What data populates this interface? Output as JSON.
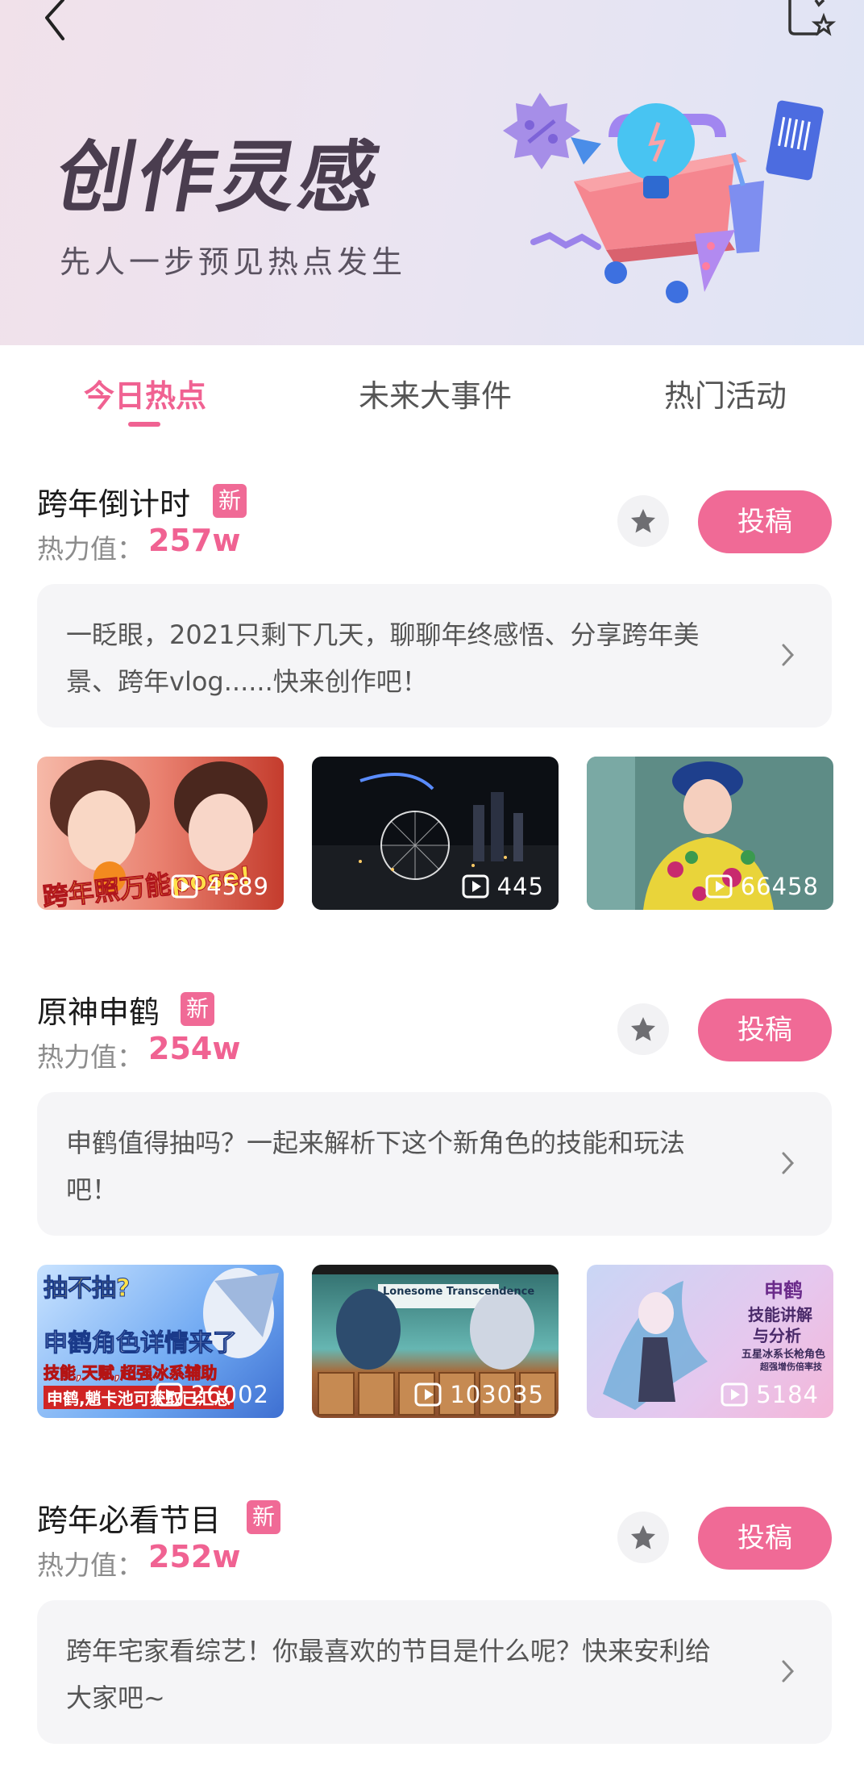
{
  "header": {
    "title": "创作灵感",
    "subtitle": "先人一步预见热点发生"
  },
  "tabs": [
    {
      "label": "今日热点"
    },
    {
      "label": "未来大事件"
    },
    {
      "label": "热门活动"
    }
  ],
  "heat_label": "热力值：",
  "new_badge": "新",
  "submit_label": "投稿",
  "topics": [
    {
      "title": "跨年倒计时",
      "heat": "257w",
      "description": "一眨眼，2021只剩下几天，聊聊年终感悟、分享跨年美景、跨年vlog......快来创作吧！",
      "thumbs": [
        {
          "count": "4589",
          "caption": "跨年照万能pose!"
        },
        {
          "count": "445"
        },
        {
          "count": "66458"
        }
      ]
    },
    {
      "title": "原神申鹤",
      "heat": "254w",
      "description": "申鹤值得抽吗？一起来解析下这个新角色的技能和玩法吧！",
      "thumbs": [
        {
          "count": "26002",
          "lines": [
            "抽不抽?",
            "申鹤角色详情来了",
            "技能,天赋,超强冰系辅助",
            "申鹤,魈卡池可获取已汇总"
          ]
        },
        {
          "count": "103035",
          "caption": "Lonesome Transcendence"
        },
        {
          "count": "5184",
          "lines": [
            "申鹤",
            "技能讲解",
            "与分析",
            "五星冰系长枪角色",
            "超强增伤倍率技"
          ]
        }
      ]
    },
    {
      "title": "跨年必看节目",
      "heat": "252w",
      "description": "跨年宅家看综艺！你最喜欢的节目是什么呢？快来安利给大家吧~"
    }
  ],
  "colors": {
    "accent": "#f06292",
    "badge": "#f06a96",
    "card": "#f5f5f7"
  }
}
